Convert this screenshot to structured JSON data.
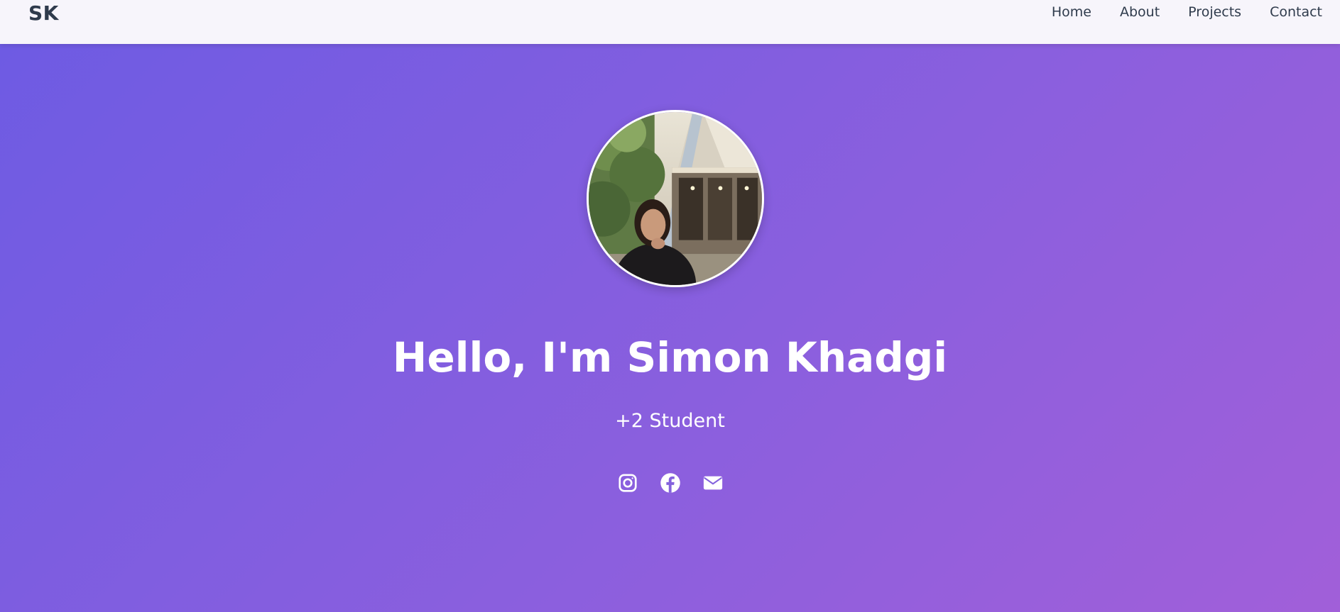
{
  "nav": {
    "logo": "SK",
    "links": [
      "Home",
      "About",
      "Projects",
      "Contact"
    ]
  },
  "hero": {
    "title": "Hello, I'm Simon Khadgi",
    "subtitle": "+2 Student",
    "socials": [
      {
        "icon": "instagram-icon"
      },
      {
        "icon": "facebook-icon"
      },
      {
        "icon": "envelope-icon"
      }
    ]
  },
  "colors": {
    "nav_bg": "#f7f5fb",
    "nav_text": "#2f3b4c",
    "gradient_start": "#6e5be3",
    "gradient_end": "#a15fd9",
    "hero_text": "#ffffff"
  }
}
